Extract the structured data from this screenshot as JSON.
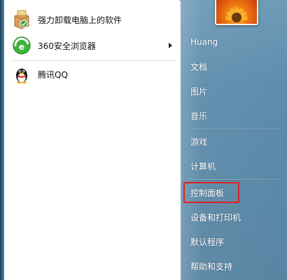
{
  "programs": [
    {
      "label": "强力卸载电脑上的软件",
      "icon": "uninstaller-box-icon"
    },
    {
      "label": "360安全浏览器",
      "icon": "browser-360-icon",
      "has_submenu": true
    },
    {
      "label": "腾讯QQ",
      "icon": "qq-penguin-icon"
    }
  ],
  "right_pane": {
    "items": [
      {
        "label": "Huang"
      },
      {
        "label": "文档"
      },
      {
        "label": "图片"
      },
      {
        "label": "音乐"
      },
      {
        "label": "游戏"
      },
      {
        "label": "计算机"
      },
      {
        "label": "控制面板",
        "highlighted": true
      },
      {
        "label": "设备和打印机"
      },
      {
        "label": "默认程序"
      },
      {
        "label": "帮助和支持"
      }
    ],
    "highlight_color": "#e02020"
  },
  "colors": {
    "left_pane_bg": "#ffffff",
    "right_pane_bg": "#5e8dac"
  }
}
